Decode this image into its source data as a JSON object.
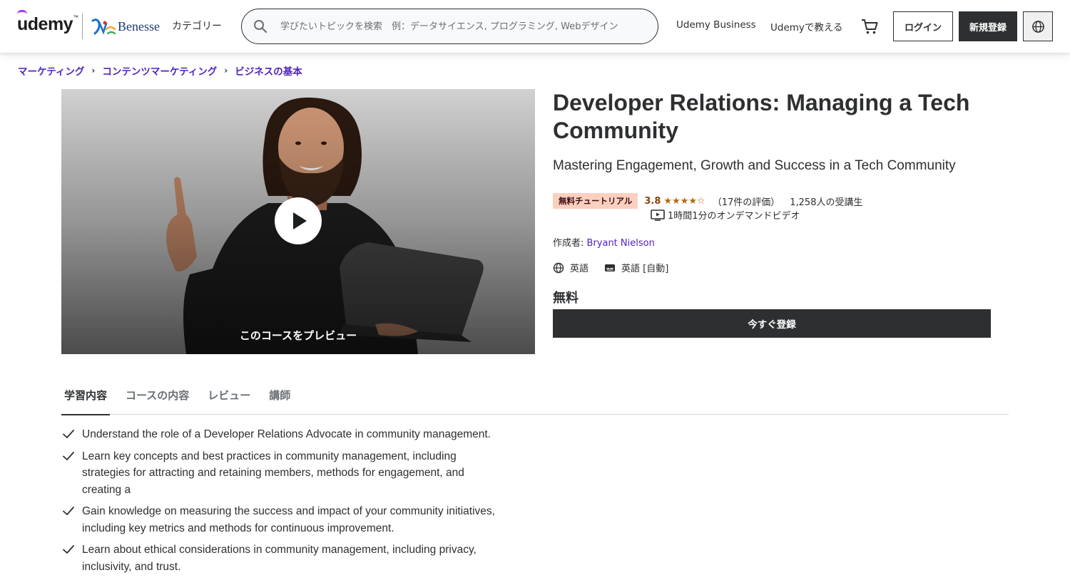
{
  "header": {
    "logo_text": "udemy",
    "partner_text": "Benesse",
    "category_label": "カテゴリー",
    "search_placeholder": "学びたいトピックを検索　例：データサイエンス, プログラミング, Webデザイン",
    "business_label": "Udemy Business",
    "teach_label": "Udemyで教える",
    "login_label": "ログイン",
    "signup_label": "新規登録"
  },
  "breadcrumb": [
    {
      "label": "マーケティング"
    },
    {
      "label": "コンテンツマーケティング"
    },
    {
      "label": "ビジネスの基本"
    }
  ],
  "preview": {
    "label": "このコースをプレビュー"
  },
  "course": {
    "title": "Developer Relations: Managing a Tech Community",
    "subtitle": "Mastering Engagement, Growth and Success in a Tech Community",
    "badge": "無料チュートリアル",
    "rating": "3.8",
    "rating_count": "（17件の評価）",
    "students": "1,258人の受講生",
    "video_length": "1時間1分のオンデマンドビデオ",
    "author_prefix": "作成者: ",
    "author_name": "Bryant Nielson",
    "language": "英語",
    "captions": "英語 [自動]",
    "price": "無料",
    "enroll_label": "今すぐ登録"
  },
  "tabs": [
    {
      "label": "学習内容",
      "active": true
    },
    {
      "label": "コースの内容",
      "active": false
    },
    {
      "label": "レビュー",
      "active": false
    },
    {
      "label": "講師",
      "active": false
    }
  ],
  "learning": [
    "Understand the role of a Developer Relations Advocate in community management.",
    "Learn key concepts and best practices in community management, including strategies for attracting and retaining members, methods for engagement, and creating a",
    "Gain knowledge on measuring the success and impact of your community initiatives, including key metrics and methods for continuous improvement.",
    "Learn about ethical considerations in community management, including privacy, inclusivity, and trust."
  ],
  "colors": {
    "brand_purple": "#a435f0",
    "link_purple": "#5022c3",
    "dark": "#2d2f31",
    "star": "#b4690e",
    "badge_bg": "#fbd0bf"
  }
}
